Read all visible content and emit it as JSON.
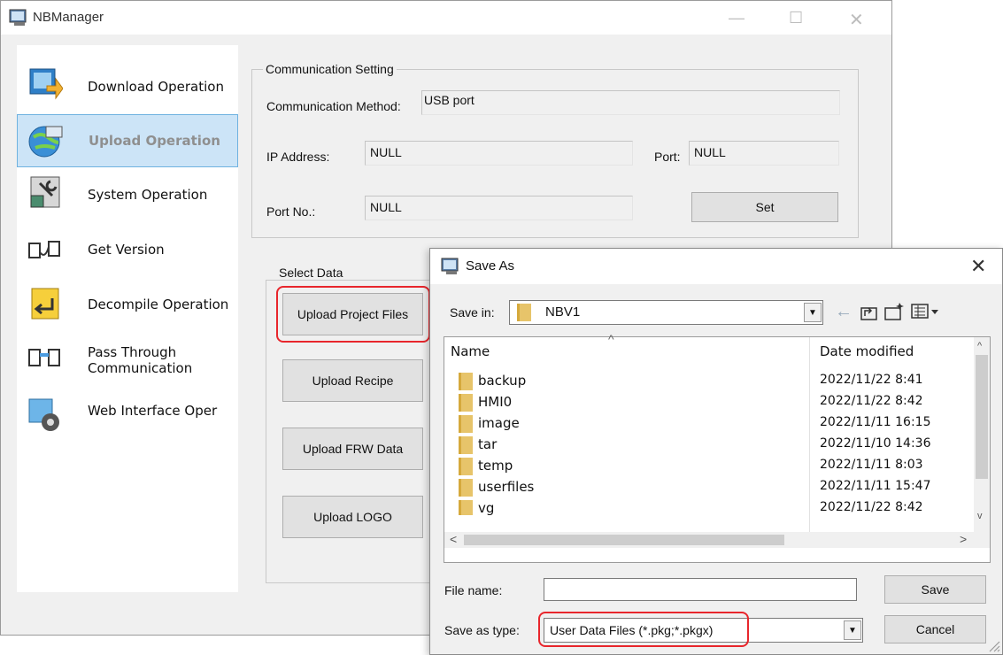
{
  "window": {
    "title": "NBManager"
  },
  "sidebar": {
    "items": [
      {
        "label": "Download Operation",
        "icon": "download-icon"
      },
      {
        "label": "Upload Operation",
        "icon": "upload-globe-icon",
        "active": true
      },
      {
        "label": "System Operation",
        "icon": "system-wrench-icon"
      },
      {
        "label": "Get Version",
        "icon": "get-version-icon"
      },
      {
        "label": "Decompile Operation",
        "icon": "decompile-icon"
      },
      {
        "label": "Pass Through",
        "label2": "Communication",
        "icon": "pass-through-icon"
      },
      {
        "label": "Web Interface Oper",
        "icon": "web-gear-icon"
      }
    ]
  },
  "communication": {
    "legend": "Communication Setting",
    "method_label": "Communication Method:",
    "method_value": "USB port",
    "ip_label": "IP Address:",
    "ip_value": "NULL",
    "port_label": "Port:",
    "port_value": "NULL",
    "portno_label": "Port No.:",
    "portno_value": "NULL",
    "set_button": "Set"
  },
  "select_data": {
    "legend": "Select Data",
    "buttons": [
      "Upload Project Files",
      "Upload Recipe",
      "Upload FRW Data",
      "Upload LOGO"
    ]
  },
  "save_dialog": {
    "title": "Save As",
    "save_in_label": "Save in:",
    "save_in_value": "NBV1",
    "col_name": "Name",
    "col_date": "Date modified",
    "files": [
      {
        "name": "backup",
        "date": "2022/11/22 8:41"
      },
      {
        "name": "HMI0",
        "date": "2022/11/22 8:42"
      },
      {
        "name": "image",
        "date": "2022/11/11 16:15"
      },
      {
        "name": "tar",
        "date": "2022/11/10 14:36"
      },
      {
        "name": "temp",
        "date": "2022/11/11 8:03"
      },
      {
        "name": "userfiles",
        "date": "2022/11/11 15:47"
      },
      {
        "name": "vg",
        "date": "2022/11/22 8:42"
      }
    ],
    "file_name_label": "File name:",
    "file_name_value": "",
    "save_type_label": "Save as type:",
    "save_type_value": "User Data Files (*.pkg;*.pkgx)",
    "save_button": "Save",
    "cancel_button": "Cancel"
  },
  "colors": {
    "highlight": "#e8262c",
    "selection": "#cce4f7",
    "folder": "#e7c46a"
  }
}
